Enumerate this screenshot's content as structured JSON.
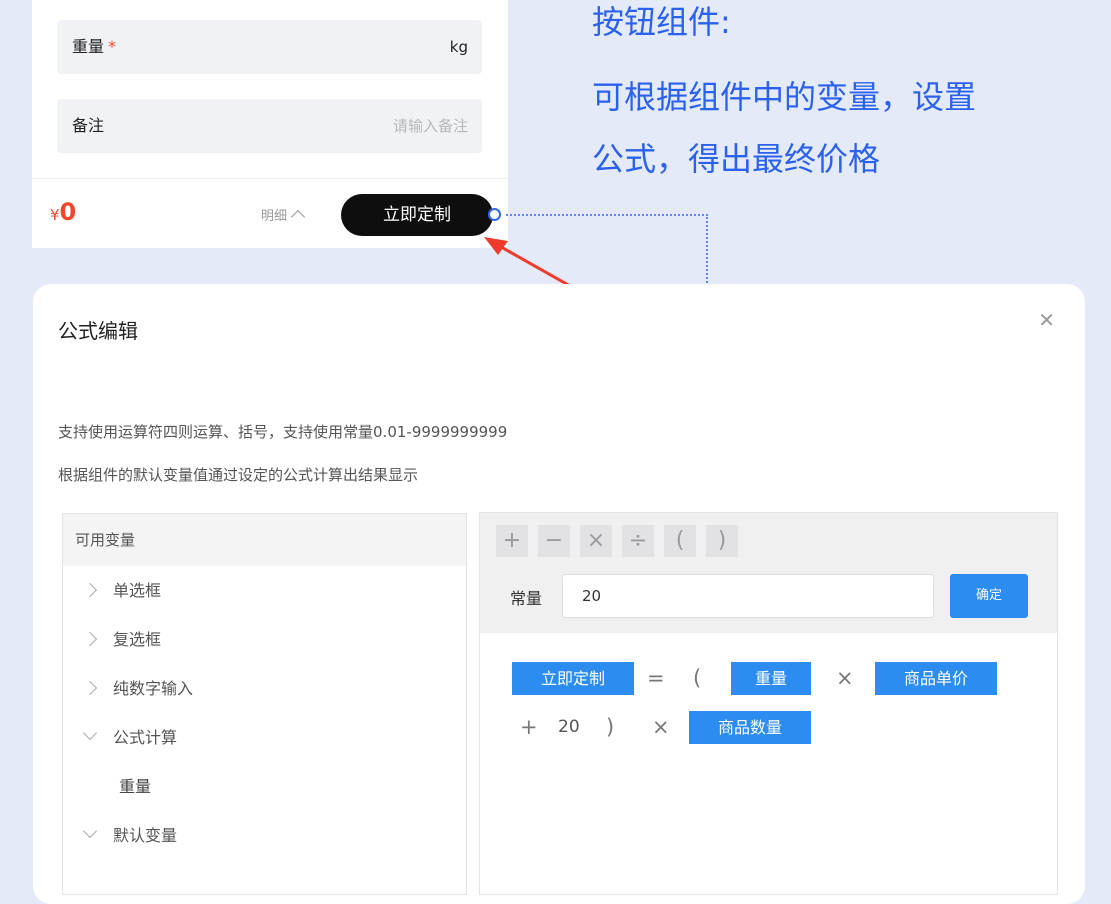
{
  "form": {
    "weight_label": "重量",
    "weight_required": "*",
    "weight_unit": "kg",
    "note_label": "备注",
    "note_placeholder": "请输入备注",
    "price_symbol": "¥",
    "price_value": "0",
    "detail_label": "明细",
    "order_button": "立即定制"
  },
  "annotation": {
    "title": "按钮组件:",
    "line1": "可根据组件中的变量，设置",
    "line2": "公式，得出最终价格"
  },
  "dialog": {
    "title": "公式编辑",
    "close_icon": "close-icon",
    "desc1": "支持使用运算符四则运算、括号，支持使用常量0.01-9999999999",
    "desc2": "根据组件的默认变量值通过设定的公式计算出结果显示",
    "variables": {
      "header": "可用变量",
      "items": [
        "单选框",
        "复选框",
        "纯数字输入",
        "公式计算",
        "重量",
        "默认变量"
      ]
    },
    "operators": [
      "+",
      "−",
      "×",
      "÷",
      "(",
      ")"
    ],
    "constant_label": "常量",
    "constant_value": "20",
    "confirm_button": "确定",
    "formula": {
      "target": "立即定制",
      "equals": "=",
      "lparen": "(",
      "var_weight": "重量",
      "times1": "×",
      "var_unit_price": "商品单价",
      "plus": "+",
      "const": "20",
      "rparen": ")",
      "times2": "×",
      "var_quantity": "商品数量"
    }
  },
  "colors": {
    "accent_blue": "#2d8cf0",
    "annotation_blue": "#2a62ef",
    "price_red": "#f5462c",
    "background": "#e5eaf9"
  }
}
